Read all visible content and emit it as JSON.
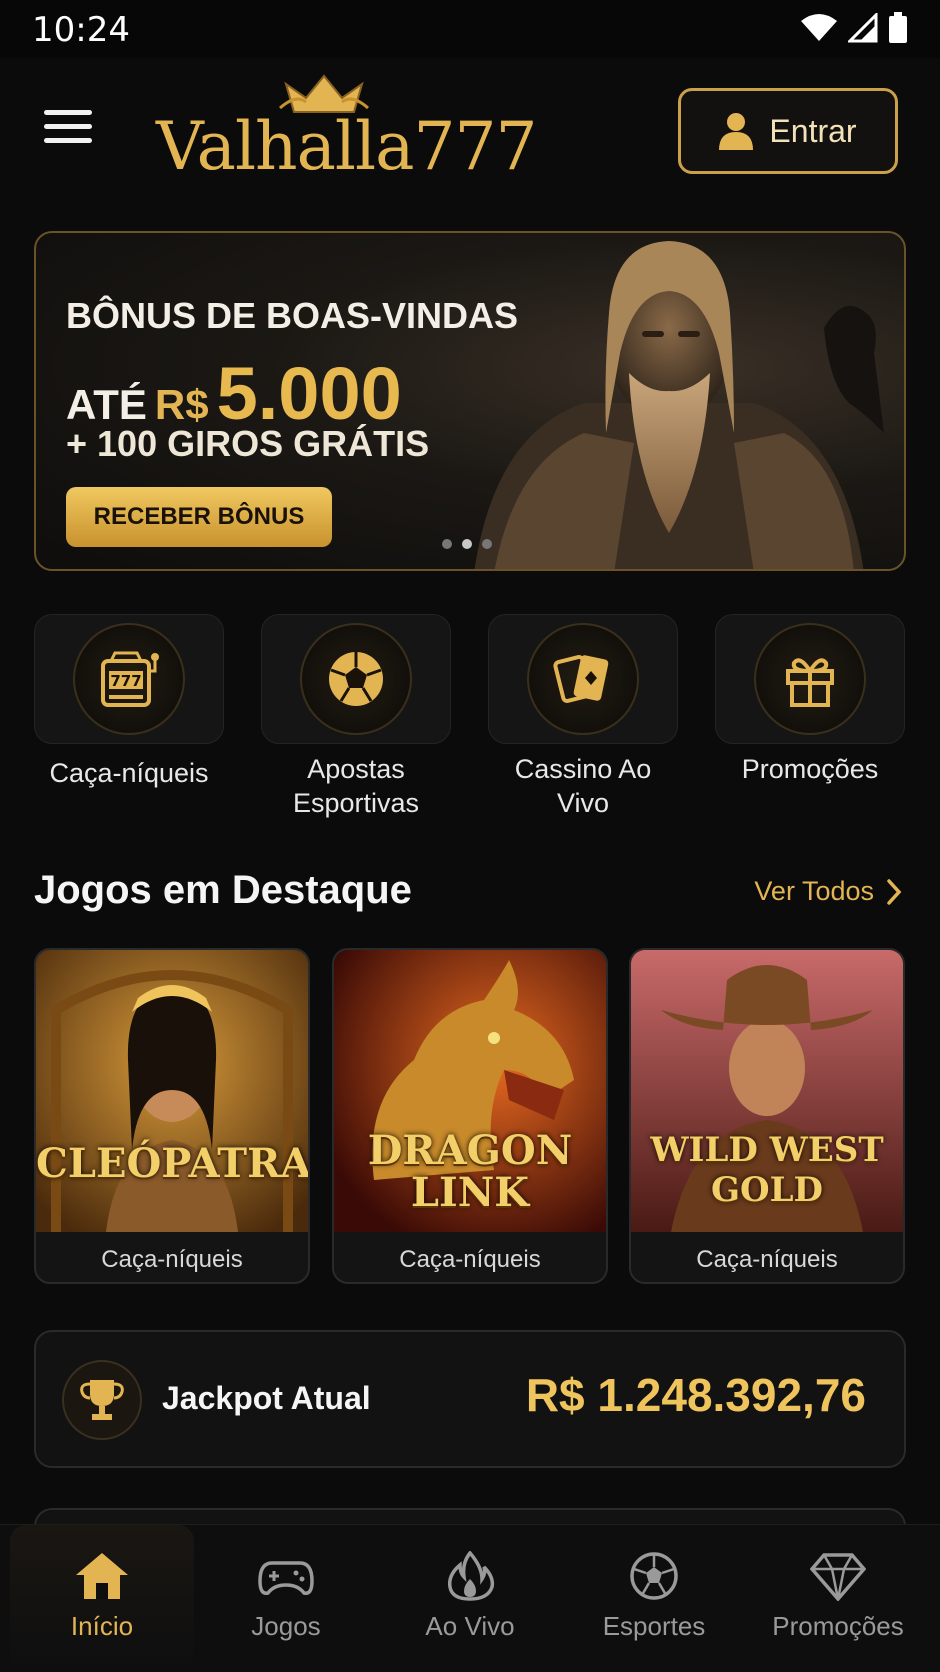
{
  "status_bar": {
    "time": "10:24"
  },
  "header": {
    "logo_text": "Valhalla777",
    "login_label": "Entrar"
  },
  "banner": {
    "line1": "BÔNUS DE BOAS-VINDAS",
    "prefix": "ATÉ",
    "currency": "R$",
    "amount": "5.000",
    "line3": "+ 100 GIROS GRÁTIS",
    "cta": "RECEBER BÔNUS",
    "slides": 3,
    "active_slide": 2
  },
  "categories": [
    {
      "label": "Caça-níqueis",
      "icon": "slot-machine-icon"
    },
    {
      "label": "Apostas Esportivas",
      "icon": "soccer-ball-icon"
    },
    {
      "label": "Cassino Ao Vivo",
      "icon": "playing-cards-icon"
    },
    {
      "label": "Promoções",
      "icon": "gift-icon"
    }
  ],
  "featured": {
    "title": "Jogos em Destaque",
    "see_all": "Ver Todos",
    "games": [
      {
        "name": "CLEÓPATRA",
        "category": "Caça-níqueis"
      },
      {
        "name": "DRAGON LINK",
        "name_l1": "DRAGON",
        "name_l2": "LINK",
        "category": "Caça-níqueis"
      },
      {
        "name": "WILD WEST GOLD",
        "name_l1": "WILD WEST",
        "name_l2": "GOLD",
        "category": "Caça-níqueis"
      }
    ]
  },
  "jackpot": {
    "label": "Jackpot Atual",
    "value": "R$ 1.248.392,76"
  },
  "bottom_nav": [
    {
      "label": "Início",
      "icon": "home-icon",
      "active": true
    },
    {
      "label": "Jogos",
      "icon": "gamepad-icon",
      "active": false
    },
    {
      "label": "Ao Vivo",
      "icon": "flame-icon",
      "active": false
    },
    {
      "label": "Esportes",
      "icon": "soccer-ball-icon",
      "active": false
    },
    {
      "label": "Promoções",
      "icon": "diamond-icon",
      "active": false
    }
  ],
  "colors": {
    "accent": "#e3b552",
    "background": "#0b0b0c",
    "card": "#151515"
  }
}
